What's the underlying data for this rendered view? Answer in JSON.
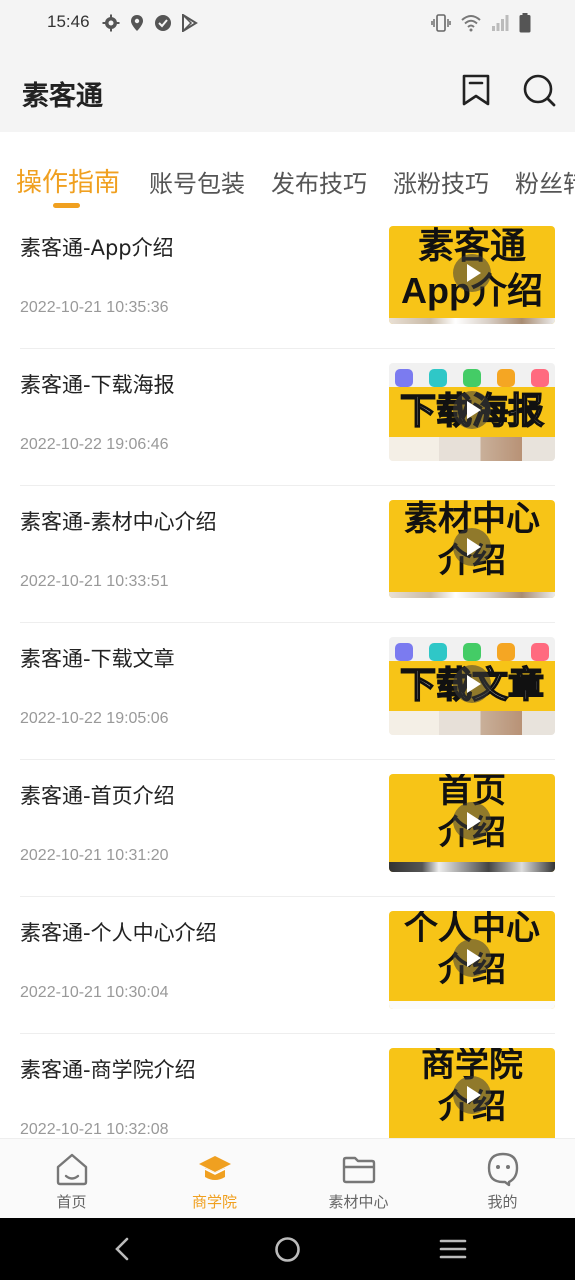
{
  "status_bar": {
    "time": "15:46",
    "left_icons": [
      "gear-icon",
      "location-icon",
      "check-circle-icon",
      "play-store-icon"
    ],
    "right_icons": [
      "vibrate-icon",
      "wifi-icon",
      "signal-icon",
      "battery-icon"
    ]
  },
  "header": {
    "title": "素客通",
    "icons": [
      "bookmark-icon",
      "search-icon"
    ]
  },
  "tabs": [
    {
      "label": "操作指南",
      "active": true
    },
    {
      "label": "账号包装",
      "active": false
    },
    {
      "label": "发布技巧",
      "active": false
    },
    {
      "label": "涨粉技巧",
      "active": false
    },
    {
      "label": "粉丝转",
      "active": false
    }
  ],
  "videos": [
    {
      "title": "素客通-App介绍",
      "date": "2022-10-21 10:35:36",
      "thumb_text": "素客通\nApp介绍",
      "thumb_style": "yellow"
    },
    {
      "title": "素客通-下载海报",
      "date": "2022-10-22 19:06:46",
      "thumb_text": "下载海报",
      "thumb_style": "white"
    },
    {
      "title": "素客通-素材中心介绍",
      "date": "2022-10-21 10:33:51",
      "thumb_text": "素材中心\n介绍",
      "thumb_style": "yellow"
    },
    {
      "title": "素客通-下载文章",
      "date": "2022-10-22 19:05:06",
      "thumb_text": "下载文章",
      "thumb_style": "white"
    },
    {
      "title": "素客通-首页介绍",
      "date": "2022-10-21 10:31:20",
      "thumb_text": "首页\n介绍",
      "thumb_style": "yellow"
    },
    {
      "title": "素客通-个人中心介绍",
      "date": "2022-10-21 10:30:04",
      "thumb_text": "个人中心\n介绍",
      "thumb_style": "yellow"
    },
    {
      "title": "素客通-商学院介绍",
      "date": "2022-10-21 10:32:08",
      "thumb_text": "商学院\n介绍",
      "thumb_style": "yellow"
    }
  ],
  "bottom_nav": [
    {
      "label": "首页",
      "icon": "home-icon",
      "active": false
    },
    {
      "label": "商学院",
      "icon": "graduation-cap-icon",
      "active": true
    },
    {
      "label": "素材中心",
      "icon": "folder-icon",
      "active": false
    },
    {
      "label": "我的",
      "icon": "profile-icon",
      "active": false
    }
  ],
  "system_nav": [
    "back-icon",
    "home-circle-icon",
    "menu-icon"
  ],
  "colors": {
    "accent": "#f0a020",
    "thumb_yellow": "#f7c417"
  }
}
